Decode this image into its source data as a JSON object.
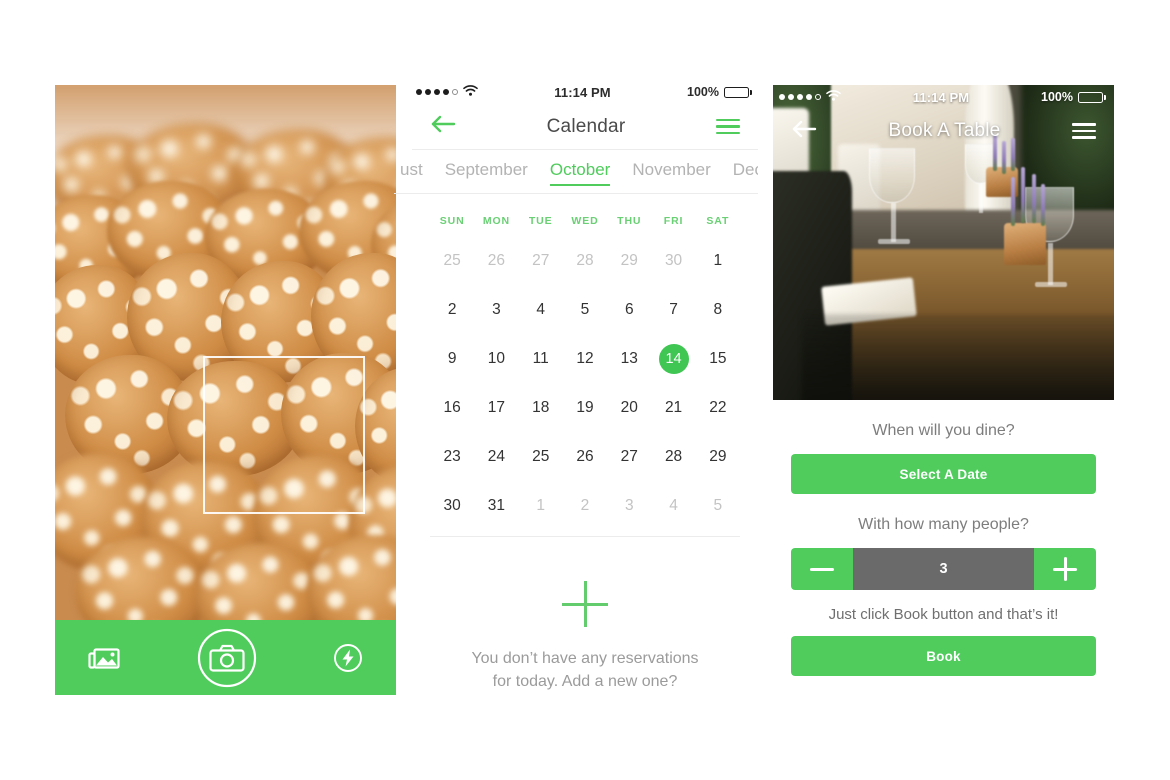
{
  "meta": {
    "accent_green": "#4fcc5c",
    "today_green": "#3fc653",
    "muted_gray": "#9b9b9b",
    "stepper_gray": "#6a6a6a"
  },
  "camera_screen": {
    "name": "camera-capture-screen",
    "toolbar": {
      "gallery_icon": "gallery-icon",
      "shutter_icon": "camera-shutter-icon",
      "flash_icon": "flash-icon"
    },
    "focus_box": "focus-rectangle"
  },
  "calendar_screen": {
    "status_bar": {
      "signal_dots_filled": 4,
      "signal_dots_total": 5,
      "wifi_icon": "wifi-icon",
      "time": "11:14 PM",
      "battery_percent": "100%",
      "battery_icon": "battery-full-icon"
    },
    "navbar": {
      "back_icon": "arrow-left-icon",
      "title": "Calendar",
      "menu_icon": "hamburger-menu-icon"
    },
    "months": [
      {
        "label": "ust",
        "active": false
      },
      {
        "label": "September",
        "active": false
      },
      {
        "label": "October",
        "active": true
      },
      {
        "label": "November",
        "active": false
      },
      {
        "label": "Dec",
        "active": false
      }
    ],
    "weekday_headers": [
      "SUN",
      "MON",
      "TUE",
      "WED",
      "THU",
      "FRI",
      "SAT"
    ],
    "weeks": [
      [
        {
          "d": "25",
          "state": "muted"
        },
        {
          "d": "26",
          "state": "muted"
        },
        {
          "d": "27",
          "state": "muted"
        },
        {
          "d": "28",
          "state": "muted"
        },
        {
          "d": "29",
          "state": "muted"
        },
        {
          "d": "30",
          "state": "muted"
        },
        {
          "d": "1",
          "state": "normal"
        }
      ],
      [
        {
          "d": "2",
          "state": "normal"
        },
        {
          "d": "3",
          "state": "normal"
        },
        {
          "d": "4",
          "state": "normal"
        },
        {
          "d": "5",
          "state": "normal"
        },
        {
          "d": "6",
          "state": "normal"
        },
        {
          "d": "7",
          "state": "normal"
        },
        {
          "d": "8",
          "state": "normal"
        }
      ],
      [
        {
          "d": "9",
          "state": "normal"
        },
        {
          "d": "10",
          "state": "normal"
        },
        {
          "d": "11",
          "state": "normal"
        },
        {
          "d": "12",
          "state": "normal"
        },
        {
          "d": "13",
          "state": "normal"
        },
        {
          "d": "14",
          "state": "today"
        },
        {
          "d": "15",
          "state": "normal"
        }
      ],
      [
        {
          "d": "16",
          "state": "normal"
        },
        {
          "d": "17",
          "state": "normal"
        },
        {
          "d": "18",
          "state": "normal"
        },
        {
          "d": "19",
          "state": "normal"
        },
        {
          "d": "20",
          "state": "normal"
        },
        {
          "d": "21",
          "state": "normal"
        },
        {
          "d": "22",
          "state": "normal"
        }
      ],
      [
        {
          "d": "23",
          "state": "normal"
        },
        {
          "d": "24",
          "state": "normal"
        },
        {
          "d": "25",
          "state": "normal"
        },
        {
          "d": "26",
          "state": "normal"
        },
        {
          "d": "27",
          "state": "normal"
        },
        {
          "d": "28",
          "state": "normal"
        },
        {
          "d": "29",
          "state": "normal"
        }
      ],
      [
        {
          "d": "30",
          "state": "normal"
        },
        {
          "d": "31",
          "state": "normal"
        },
        {
          "d": "1",
          "state": "muted"
        },
        {
          "d": "2",
          "state": "muted"
        },
        {
          "d": "3",
          "state": "muted"
        },
        {
          "d": "4",
          "state": "muted"
        },
        {
          "d": "5",
          "state": "muted"
        }
      ]
    ],
    "empty_state": {
      "add_icon": "plus-icon",
      "line1": "You don’t have any reservations",
      "line2": "for today. Add a new one?"
    }
  },
  "book_screen": {
    "status_bar": {
      "signal_dots_filled": 4,
      "signal_dots_total": 5,
      "wifi_icon": "wifi-icon",
      "time": "11:14 PM",
      "battery_percent": "100%",
      "battery_icon": "battery-full-icon"
    },
    "navbar": {
      "back_icon": "arrow-left-icon",
      "title": "Book A Table",
      "menu_icon": "hamburger-menu-icon"
    },
    "date_label": "When will you dine?",
    "date_button": "Select A Date",
    "people_label": "With how many people?",
    "people_count": "3",
    "decrement_icon": "minus-icon",
    "increment_icon": "plus-icon",
    "book_note": "Just click Book button and that’s it!",
    "book_button": "Book"
  }
}
